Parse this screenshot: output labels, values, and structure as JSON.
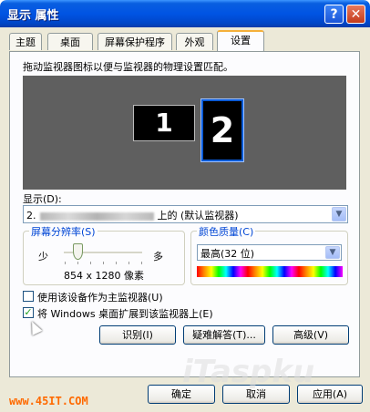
{
  "window": {
    "title": "显示 属性"
  },
  "titlebar": {
    "help_icon": "?",
    "close_icon": "✕"
  },
  "tabs": [
    {
      "label": "主题"
    },
    {
      "label": "桌面"
    },
    {
      "label": "屏幕保护程序"
    },
    {
      "label": "外观"
    },
    {
      "label": "设置",
      "active": true
    }
  ],
  "settings": {
    "instruction": "拖动监视器图标以便与监视器的物理设置匹配。",
    "monitors": [
      {
        "label": "1"
      },
      {
        "label": "2",
        "selected": true
      }
    ],
    "display_label": "显示(D):",
    "display_value_prefix": "2.",
    "display_value_suffix": "上的 (默认监视器)",
    "resolution": {
      "group_label": "屏幕分辨率(S)",
      "less_label": "少",
      "more_label": "多",
      "value": "854 x 1280 像素",
      "slider_position_fraction": 0.12
    },
    "color_quality": {
      "group_label": "颜色质量(C)",
      "selected": "最高(32 位)"
    },
    "checkbox_primary": {
      "label": "使用该设备作为主监视器(U)",
      "checked": false
    },
    "checkbox_extend": {
      "label": "将 Windows 桌面扩展到该监视器上(E)",
      "checked": true
    },
    "buttons": {
      "identify": "识别(I)",
      "troubleshoot": "疑难解答(T)...",
      "advanced": "高级(V)"
    }
  },
  "dialog_buttons": {
    "ok": "确定",
    "cancel": "取消",
    "apply": "应用(A)"
  },
  "watermarks": {
    "left": "www.45IT.COM",
    "right": "iTaspku"
  },
  "colors": {
    "titlebar": "#0054e3",
    "accent_tab": "#f5b03a",
    "group_title": "#0046d5",
    "monitor_bg": "#5f5f5f"
  }
}
